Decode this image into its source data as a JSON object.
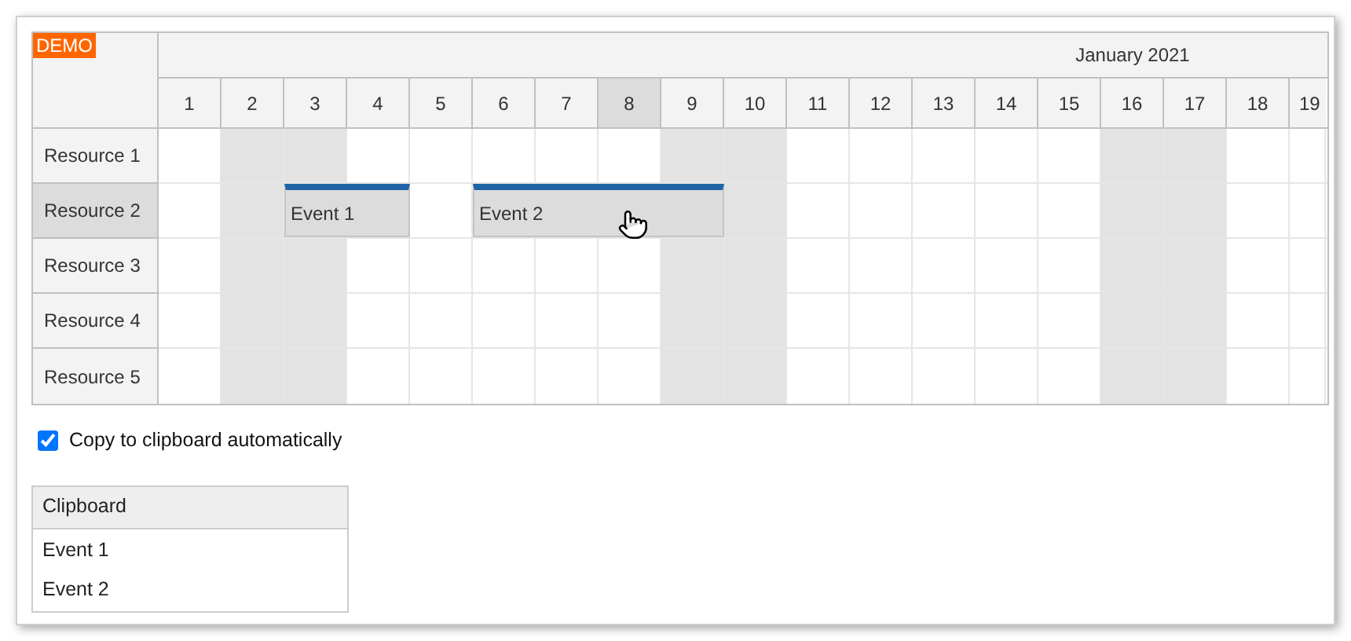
{
  "demo_badge": "DEMO",
  "month": "January 2021",
  "days": [
    {
      "label": "1",
      "weekend": false,
      "selected": false
    },
    {
      "label": "2",
      "weekend": true,
      "selected": false
    },
    {
      "label": "3",
      "weekend": true,
      "selected": false
    },
    {
      "label": "4",
      "weekend": false,
      "selected": false
    },
    {
      "label": "5",
      "weekend": false,
      "selected": false
    },
    {
      "label": "6",
      "weekend": false,
      "selected": false
    },
    {
      "label": "7",
      "weekend": false,
      "selected": false
    },
    {
      "label": "8",
      "weekend": false,
      "selected": true
    },
    {
      "label": "9",
      "weekend": true,
      "selected": false
    },
    {
      "label": "10",
      "weekend": true,
      "selected": false
    },
    {
      "label": "11",
      "weekend": false,
      "selected": false
    },
    {
      "label": "12",
      "weekend": false,
      "selected": false
    },
    {
      "label": "13",
      "weekend": false,
      "selected": false
    },
    {
      "label": "14",
      "weekend": false,
      "selected": false
    },
    {
      "label": "15",
      "weekend": false,
      "selected": false
    },
    {
      "label": "16",
      "weekend": true,
      "selected": false
    },
    {
      "label": "17",
      "weekend": true,
      "selected": false
    },
    {
      "label": "18",
      "weekend": false,
      "selected": false
    },
    {
      "label": "19",
      "weekend": false,
      "selected": false
    }
  ],
  "resources": [
    {
      "name": "Resource 1",
      "selected": false
    },
    {
      "name": "Resource 2",
      "selected": true,
      "events": [
        {
          "text": "Event 1"
        },
        {
          "text": "Event 2"
        }
      ]
    },
    {
      "name": "Resource 3",
      "selected": false
    },
    {
      "name": "Resource 4",
      "selected": false
    },
    {
      "name": "Resource 5",
      "selected": false
    }
  ],
  "auto_copy": {
    "label": "Copy to clipboard automatically",
    "checked": true
  },
  "clipboard": {
    "title": "Clipboard",
    "items": [
      "Event 1",
      "Event 2"
    ]
  }
}
